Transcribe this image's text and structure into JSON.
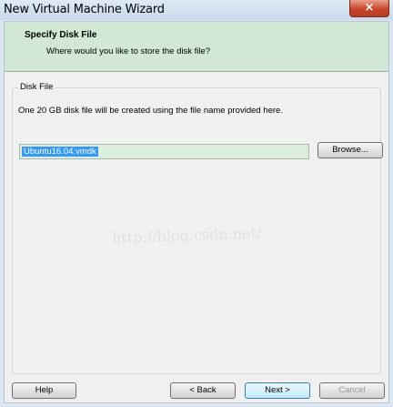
{
  "window": {
    "title": "New Virtual Machine Wizard",
    "close_glyph": "×"
  },
  "header": {
    "title": "Specify Disk File",
    "subtitle": "Where would you like to store the disk file?"
  },
  "disk_file": {
    "group_label": "Disk File",
    "description": "One 20 GB disk file will be created using the file name provided here.",
    "filename": "Ubuntu16.04.vmdk"
  },
  "buttons": {
    "browse": "Browse...",
    "help": "Help",
    "back": "< Back",
    "next": "Next >",
    "cancel": "Cancel"
  },
  "watermark": "http://blog.csdn.net/"
}
